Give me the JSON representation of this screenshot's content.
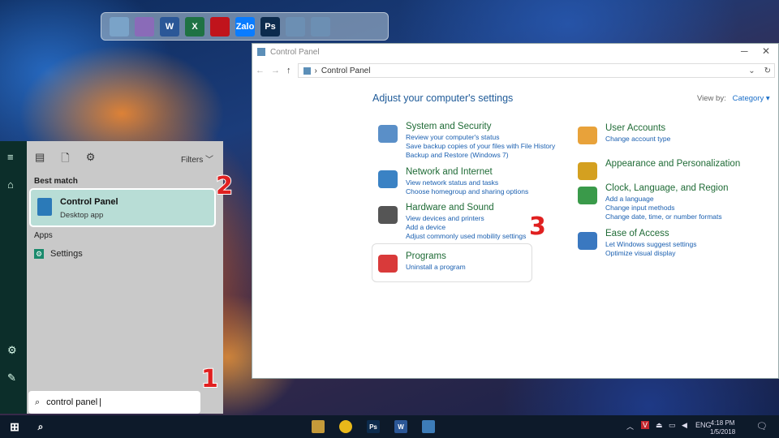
{
  "dock": {
    "items": [
      {
        "name": "computer-icon",
        "color": "#7aa3c8"
      },
      {
        "name": "recycle-bin-icon",
        "color": "#8a6bb8"
      },
      {
        "name": "word-icon",
        "color": "#2b5797",
        "label": "W"
      },
      {
        "name": "excel-icon",
        "color": "#1f7244",
        "label": "X"
      },
      {
        "name": "garena-icon",
        "color": "#c0141c"
      },
      {
        "name": "zalo-icon",
        "color": "#0a7cff",
        "label": "Zalo"
      },
      {
        "name": "photoshop-icon",
        "color": "#0c2b4d",
        "label": "Ps"
      },
      {
        "name": "folder-icon",
        "color": "#6c8fb3"
      },
      {
        "name": "folder-icon",
        "color": "#6c8fb3"
      }
    ]
  },
  "window": {
    "title": "Control Panel",
    "address": "Control Panel",
    "heading": "Adjust your computer's settings",
    "view_by_label": "View by:",
    "view_by_value": "Category",
    "categories_left": [
      {
        "title": "System and Security",
        "links": [
          "Review your computer's status",
          "Save backup copies of your files with File History",
          "Backup and Restore (Windows 7)"
        ]
      },
      {
        "title": "Network and Internet",
        "links": [
          "View network status and tasks",
          "Choose homegroup and sharing options"
        ]
      },
      {
        "title": "Hardware and Sound",
        "links": [
          "View devices and printers",
          "Add a device",
          "Adjust commonly used mobility settings"
        ]
      },
      {
        "title": "Programs",
        "links": [
          "Uninstall a program"
        ]
      }
    ],
    "categories_right": [
      {
        "title": "User Accounts",
        "links": [
          "Change account type"
        ]
      },
      {
        "title": "Appearance and Personalization",
        "links": []
      },
      {
        "title": "Clock, Language, and Region",
        "links": [
          "Add a language",
          "Change input methods",
          "Change date, time, or number formats"
        ]
      },
      {
        "title": "Ease of Access",
        "links": [
          "Let Windows suggest settings",
          "Optimize visual display"
        ]
      }
    ]
  },
  "start_menu": {
    "filters_label": "Filters",
    "best_match_label": "Best match",
    "best_match_title": "Control Panel",
    "best_match_sub": "Desktop app",
    "apps_label": "Apps",
    "apps": [
      "Settings"
    ],
    "search_value": "control panel"
  },
  "steps": [
    "1",
    "2",
    "3"
  ],
  "taskbar": {
    "language": "ENG",
    "time": "4:18 PM",
    "date": "1/5/2018"
  }
}
